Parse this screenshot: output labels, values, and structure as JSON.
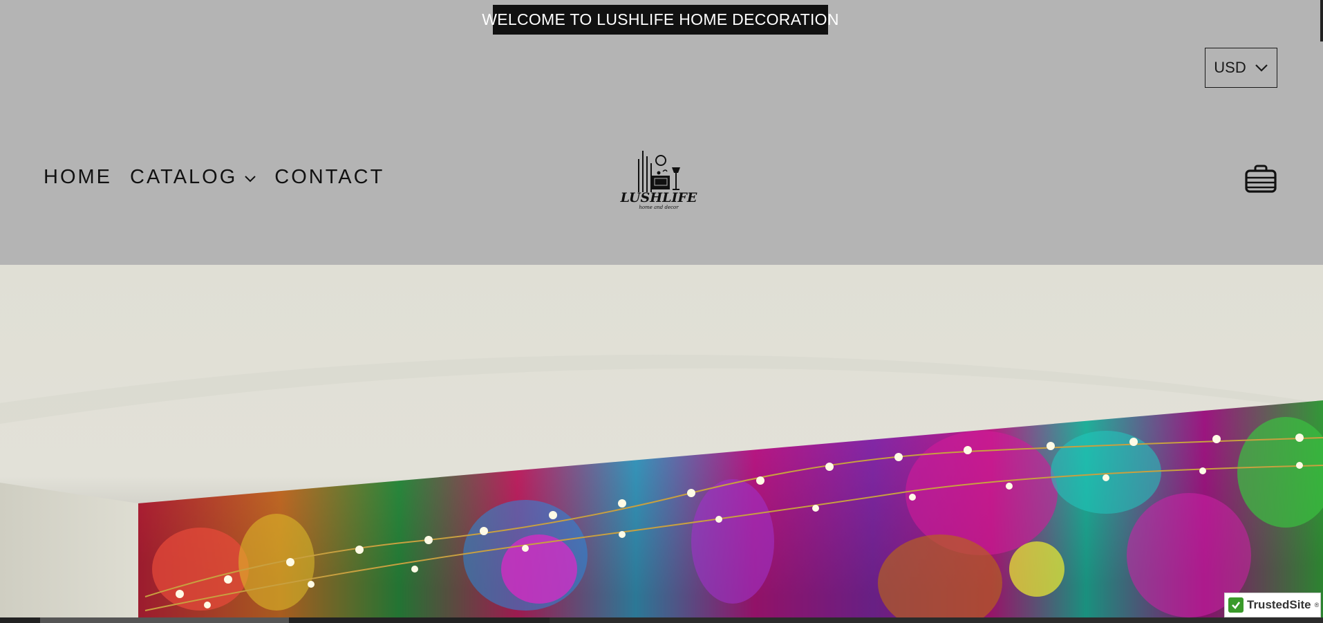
{
  "announcement": {
    "text": "WELCOME TO LUSHLIFE HOME DECORATION"
  },
  "currency": {
    "selected": "USD",
    "icon": "chevron-down-icon"
  },
  "nav": {
    "items": [
      {
        "label": "HOME"
      },
      {
        "label": "CATALOG",
        "icon": "chevron-down-icon"
      },
      {
        "label": "CONTACT"
      }
    ]
  },
  "logo": {
    "brand": "LUSHLIFE",
    "tagline": "home and decor"
  },
  "cart": {
    "icon": "shopping-bag-icon"
  },
  "badge": {
    "text": "TrustedSite",
    "mark": "®"
  },
  "colors": {
    "header_bg": "#b4b4b4",
    "announcement_bg": "#111111",
    "badge_green": "#3a9a2a"
  }
}
